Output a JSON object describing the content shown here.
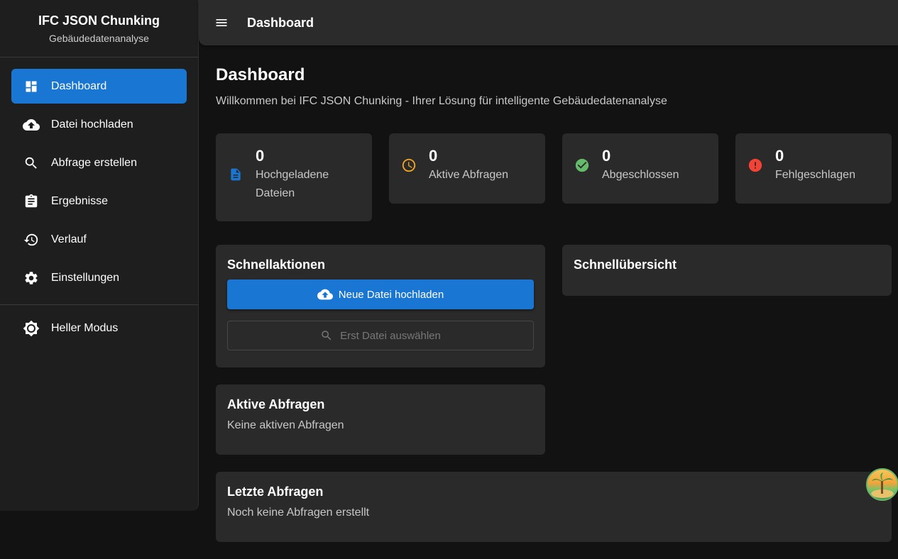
{
  "brand": {
    "title": "IFC JSON Chunking",
    "subtitle": "Gebäudedatenanalyse"
  },
  "sidebar": {
    "items": [
      {
        "label": "Dashboard",
        "icon": "dashboard-icon",
        "active": true
      },
      {
        "label": "Datei hochladen",
        "icon": "cloud-upload-icon"
      },
      {
        "label": "Abfrage erstellen",
        "icon": "search-icon"
      },
      {
        "label": "Ergebnisse",
        "icon": "clipboard-icon"
      },
      {
        "label": "Verlauf",
        "icon": "history-icon"
      },
      {
        "label": "Einstellungen",
        "icon": "gear-icon"
      }
    ],
    "theme_toggle": {
      "label": "Heller Modus",
      "icon": "brightness-icon"
    }
  },
  "appbar": {
    "title": "Dashboard"
  },
  "page": {
    "title": "Dashboard",
    "subtitle": "Willkommen bei IFC JSON Chunking - Ihrer Lösung für intelligente Gebäudedatenanalyse"
  },
  "stats": [
    {
      "value": "0",
      "label": "Hochgeladene Dateien",
      "icon": "file-icon",
      "color": "#1976d2"
    },
    {
      "value": "0",
      "label": "Aktive Abfragen",
      "icon": "clock-icon",
      "color": "#f5a623"
    },
    {
      "value": "0",
      "label": "Abgeschlossen",
      "icon": "check-circle-icon",
      "color": "#66bb6a"
    },
    {
      "value": "0",
      "label": "Fehlgeschlagen",
      "icon": "error-icon",
      "color": "#f44336"
    }
  ],
  "quick_actions": {
    "title": "Schnellaktionen",
    "upload_button": "Neue Datei hochladen",
    "query_button": "Erst Datei auswählen"
  },
  "overview": {
    "title": "Schnellübersicht"
  },
  "active_queries": {
    "title": "Aktive Abfragen",
    "empty": "Keine aktiven Abfragen"
  },
  "recent_queries": {
    "title": "Letzte Abfragen",
    "empty": "Noch keine Abfragen erstellt"
  },
  "colors": {
    "accent": "#1976d2",
    "background": "#121212",
    "surface": "#2a2a2a"
  }
}
